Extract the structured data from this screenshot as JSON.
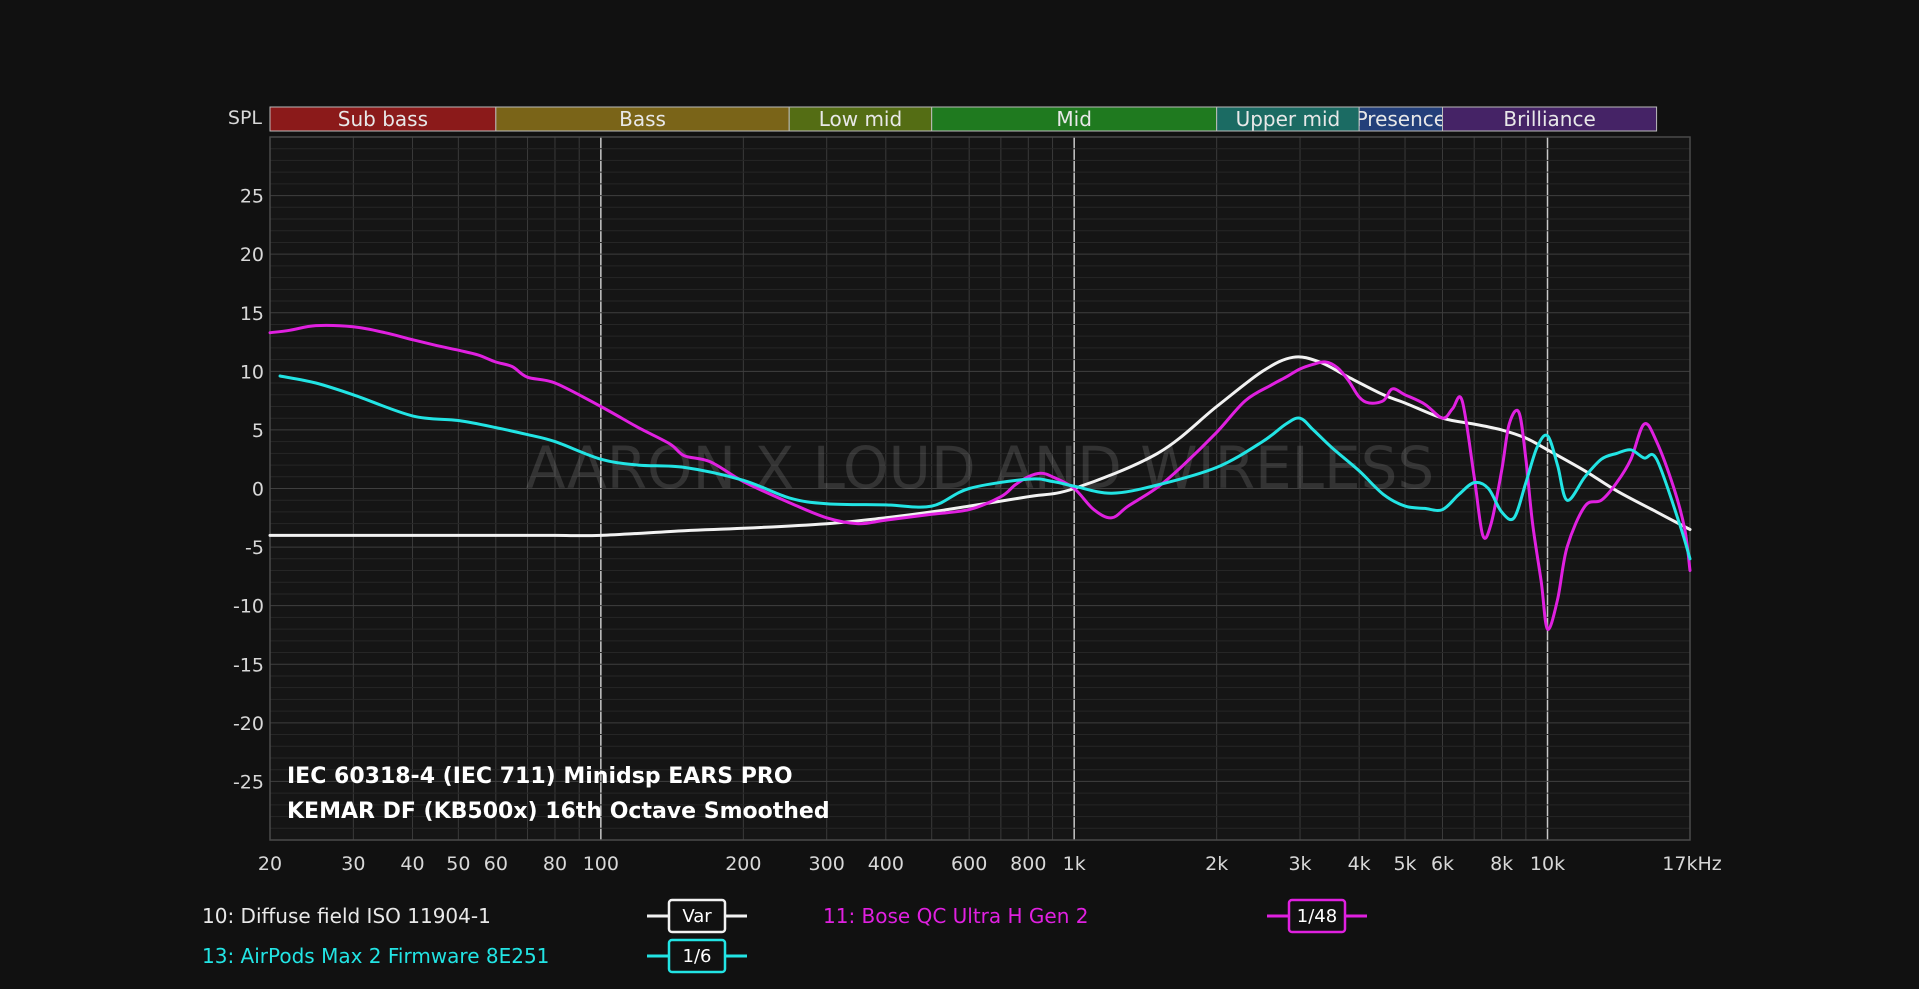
{
  "chart_data": {
    "type": "line",
    "ylabel": "SPL",
    "x_unit": "kHz",
    "x_scale": "log",
    "xlim": [
      20,
      20000
    ],
    "ylim": [
      -30,
      30
    ],
    "grid": true,
    "x_ticks": [
      {
        "value": 20,
        "label": "20"
      },
      {
        "value": 30,
        "label": "30"
      },
      {
        "value": 40,
        "label": "40"
      },
      {
        "value": 50,
        "label": "50"
      },
      {
        "value": 60,
        "label": "60"
      },
      {
        "value": 80,
        "label": "80"
      },
      {
        "value": 100,
        "label": "100"
      },
      {
        "value": 200,
        "label": "200"
      },
      {
        "value": 300,
        "label": "300"
      },
      {
        "value": 400,
        "label": "400"
      },
      {
        "value": 600,
        "label": "600"
      },
      {
        "value": 800,
        "label": "800"
      },
      {
        "value": 1000,
        "label": "1k"
      },
      {
        "value": 2000,
        "label": "2k"
      },
      {
        "value": 3000,
        "label": "3k"
      },
      {
        "value": 4000,
        "label": "4k"
      },
      {
        "value": 5000,
        "label": "5k"
      },
      {
        "value": 6000,
        "label": "6k"
      },
      {
        "value": 8000,
        "label": "8k"
      },
      {
        "value": 10000,
        "label": "10k"
      },
      {
        "value": 17000,
        "label": "17kHz"
      }
    ],
    "y_ticks": [
      25,
      20,
      15,
      10,
      5,
      0,
      -5,
      -10,
      -15,
      -20,
      -25
    ],
    "bands": [
      {
        "name": "Sub bass",
        "from": 20,
        "to": 60,
        "color": "#8b1a1a"
      },
      {
        "name": "Bass",
        "from": 60,
        "to": 250,
        "color": "#7a6418"
      },
      {
        "name": "Low mid",
        "from": 250,
        "to": 500,
        "color": "#546d14"
      },
      {
        "name": "Mid",
        "from": 500,
        "to": 2000,
        "color": "#1f7a1f"
      },
      {
        "name": "Upper mid",
        "from": 2000,
        "to": 4000,
        "color": "#1b6b63"
      },
      {
        "name": "Presence",
        "from": 4000,
        "to": 6000,
        "color": "#233f7a"
      },
      {
        "name": "Brilliance",
        "from": 6000,
        "to": 20000,
        "color": "#452366"
      }
    ],
    "annotation": [
      "IEC 60318-4 (IEC 711) Minidsp EARS PRO",
      "KEMAR DF (KB500x) 16th Octave Smoothed"
    ],
    "watermark": "AARON X LOUD AND WIRELESS",
    "series": [
      {
        "name": "10: Diffuse field ISO 11904-1",
        "badge": "Var",
        "color": "#f2f2f2",
        "x": [
          20,
          40,
          60,
          80,
          100,
          150,
          200,
          300,
          400,
          500,
          600,
          800,
          1000,
          1500,
          2000,
          2500,
          2900,
          3300,
          3800,
          4500,
          5000,
          6000,
          7000,
          8000,
          9000,
          10000,
          12000,
          14000,
          17000,
          20000
        ],
        "y": [
          -4,
          -4,
          -4,
          -4,
          -4,
          -3.6,
          -3.4,
          -3,
          -2.5,
          -2,
          -1.5,
          -0.7,
          0,
          3,
          7,
          10,
          11.2,
          10.8,
          9.5,
          8,
          7.3,
          6,
          5.5,
          5,
          4.3,
          3.3,
          1.5,
          -0.2,
          -2,
          -3.5
        ]
      },
      {
        "name": "11: Bose QC Ultra H Gen 2",
        "badge": "1/48",
        "color": "#e020e0",
        "x": [
          20,
          22,
          25,
          30,
          35,
          40,
          45,
          50,
          55,
          60,
          65,
          70,
          80,
          100,
          120,
          140,
          150,
          170,
          200,
          250,
          300,
          350,
          400,
          500,
          600,
          700,
          750,
          800,
          850,
          900,
          1000,
          1100,
          1200,
          1300,
          1500,
          1700,
          2000,
          2300,
          2600,
          2800,
          3000,
          3200,
          3400,
          3600,
          3800,
          4000,
          4200,
          4500,
          4700,
          5000,
          5500,
          6000,
          6300,
          6600,
          7000,
          7300,
          7600,
          8000,
          8300,
          8700,
          9000,
          9300,
          9700,
          10000,
          10500,
          11000,
          12000,
          13000,
          14000,
          15000,
          16000,
          17000,
          18500,
          19500,
          20000
        ],
        "y": [
          13.3,
          13.5,
          13.9,
          13.8,
          13.3,
          12.7,
          12.2,
          11.8,
          11.4,
          10.8,
          10.4,
          9.5,
          9.0,
          7.0,
          5.2,
          3.8,
          2.8,
          2.3,
          0.6,
          -1.2,
          -2.5,
          -3.0,
          -2.7,
          -2.2,
          -1.8,
          -0.7,
          0.3,
          1.0,
          1.3,
          1.0,
          0,
          -1.8,
          -2.5,
          -1.5,
          0.1,
          2.0,
          4.8,
          7.5,
          8.8,
          9.5,
          10.2,
          10.6,
          10.8,
          10.3,
          9.2,
          7.8,
          7.3,
          7.5,
          8.5,
          8.0,
          7.2,
          6.0,
          6.8,
          7.5,
          1.0,
          -4.0,
          -3.0,
          1.5,
          5.5,
          6.5,
          2.5,
          -3.0,
          -8.0,
          -12.0,
          -9.5,
          -5.0,
          -1.5,
          -1.0,
          0.5,
          2.5,
          5.5,
          4.0,
          0.0,
          -3.5,
          -7.0
        ]
      },
      {
        "name": "13: AirPods Max 2 Firmware 8E251",
        "badge": "1/6",
        "color": "#22e4e4",
        "x": [
          21,
          25,
          30,
          40,
          50,
          60,
          70,
          80,
          100,
          120,
          150,
          200,
          250,
          300,
          400,
          500,
          600,
          800,
          900,
          1000,
          1200,
          1500,
          2000,
          2500,
          2800,
          3000,
          3200,
          3500,
          4000,
          4500,
          5000,
          5500,
          6000,
          6500,
          7000,
          7500,
          8000,
          8500,
          9000,
          9500,
          10000,
          10500,
          11000,
          12000,
          13000,
          14000,
          15000,
          16000,
          17000,
          19000,
          20000
        ],
        "y": [
          9.6,
          9.0,
          8.0,
          6.2,
          5.8,
          5.2,
          4.6,
          4.0,
          2.5,
          2.0,
          1.8,
          0.7,
          -0.8,
          -1.3,
          -1.4,
          -1.5,
          0.0,
          0.8,
          0.6,
          0.2,
          -0.4,
          0.3,
          1.8,
          4.0,
          5.5,
          6.0,
          5.0,
          3.5,
          1.5,
          -0.5,
          -1.5,
          -1.7,
          -1.8,
          -0.5,
          0.5,
          0.0,
          -2.0,
          -2.5,
          0.5,
          3.5,
          4.5,
          2.0,
          -1.0,
          1.0,
          2.5,
          3.0,
          3.3,
          2.6,
          2.5,
          -3.0,
          -6.0
        ]
      }
    ]
  }
}
